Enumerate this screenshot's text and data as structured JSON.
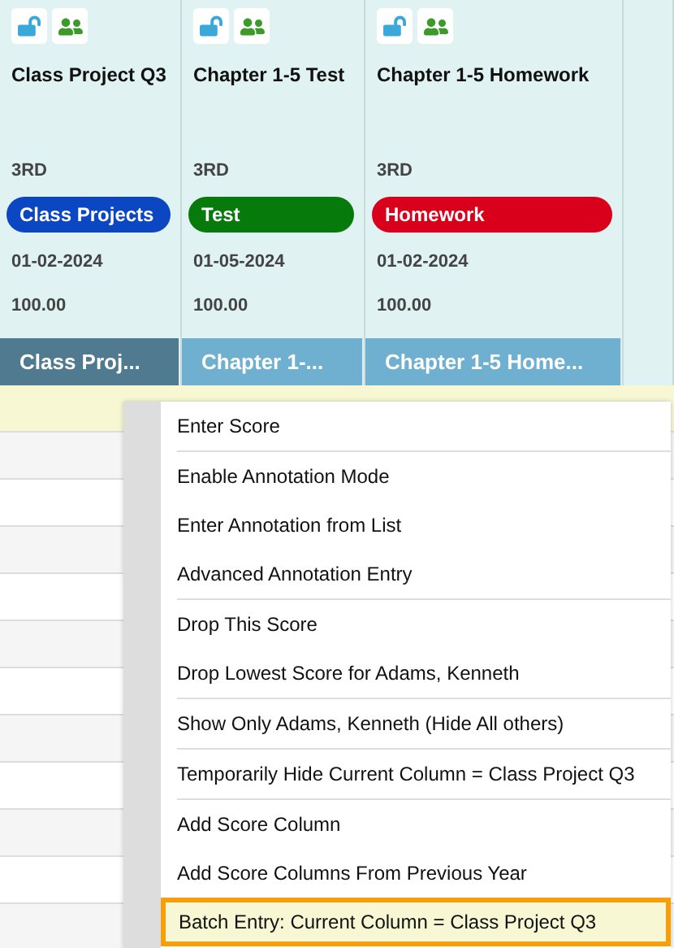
{
  "columns": [
    {
      "title": "Class Project Q3",
      "grade": "3RD",
      "category": {
        "label": "Class Projects",
        "color": "#0b47c2"
      },
      "date": "01-02-2024",
      "points": "100.00",
      "header": "Class Proj...",
      "selected": true
    },
    {
      "title": "Chapter 1-5 Test",
      "grade": "3RD",
      "category": {
        "label": "Test",
        "color": "#067a0a"
      },
      "date": "01-05-2024",
      "points": "100.00",
      "header": "Chapter 1-...",
      "selected": false
    },
    {
      "title": "Chapter 1-5 Homework",
      "grade": "3RD",
      "category": {
        "label": "Homework",
        "color": "#d9001b"
      },
      "date": "01-02-2024",
      "points": "100.00",
      "header": "Chapter 1-5 Home...",
      "selected": false
    }
  ],
  "menu": {
    "groups": [
      [
        {
          "label": "Enter Score",
          "selected": false
        }
      ],
      [
        {
          "label": "Enable Annotation Mode",
          "selected": false
        },
        {
          "label": "Enter Annotation from List",
          "selected": false
        },
        {
          "label": "Advanced Annotation Entry",
          "selected": false
        }
      ],
      [
        {
          "label": "Drop This Score",
          "selected": false
        },
        {
          "label": "Drop Lowest Score for Adams, Kenneth",
          "selected": false
        }
      ],
      [
        {
          "label": "Show Only Adams, Kenneth (Hide All others)",
          "selected": false
        }
      ],
      [
        {
          "label": "Temporarily Hide Current Column = Class Project Q3",
          "selected": false
        }
      ],
      [
        {
          "label": "Add Score Column",
          "selected": false
        },
        {
          "label": "Add Score Columns From Previous Year",
          "selected": false
        },
        {
          "label": "Batch Entry: Current Column = Class Project Q3",
          "selected": true
        }
      ]
    ]
  }
}
